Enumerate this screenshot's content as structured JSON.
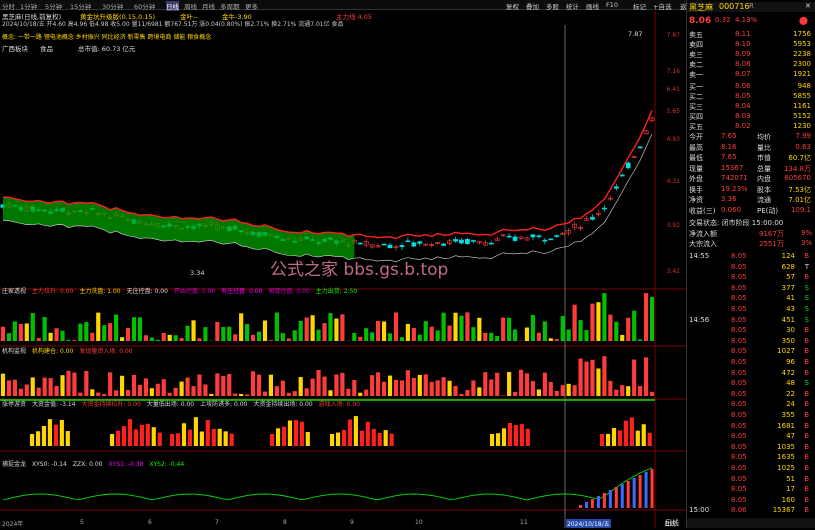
{
  "toolbar": {
    "periods": [
      "分时",
      "1分钟",
      "5分钟",
      "15分钟",
      "30分钟",
      "60分钟",
      "日线",
      "周线",
      "月线",
      "多周期",
      "更多"
    ],
    "active_period": "日线",
    "menu": [
      "复权",
      "叠加",
      "多股",
      "统计",
      "画线",
      "F10",
      "标记",
      "+自选",
      "返回"
    ]
  },
  "main": {
    "stock_label": "黑芝麻(日线,前复权)",
    "indicator_label": "黄金坑升级版(0.15,0.15)",
    "gold_line": "金叶--",
    "info_text": "2024/10/18/五 开4.60 高4.96 低4.98 收5.00 量11/6981 额767.51万 涨0.04(0.80%) 振2.71% 换2.71% 流通7.01亿 食品",
    "gold_line2": "金牛-3.90",
    "main_force_line": "主力线 4.05",
    "concept": "概念: 一带一路 锂电池概念 乡村振兴 同比经济 新零售 跨境电商 储能 粮食概念",
    "region": "广西板块",
    "industry": "食品",
    "total_cap": "总市值: 60.73 亿元",
    "low_label": "3.34",
    "high_label": "7.87",
    "price_axis": [
      "7.87",
      "7.16",
      "6.41",
      "5.65",
      "4.93",
      "4.31",
      "3.92",
      "3.42"
    ],
    "watermark": "公式之家 bbs.gs.b.top"
  },
  "panels": [
    {
      "name": "庄家透视",
      "items": [
        {
          "t": "主力拉升: 0.00",
          "c": "#ff3c3c"
        },
        {
          "t": "主力洗盘: 1.00",
          "c": "#ffd600"
        },
        {
          "t": "无庄控盘: 0.00",
          "c": "#ddd"
        },
        {
          "t": "开始控盘: 0.00",
          "c": "#c0c"
        },
        {
          "t": "有庄控盘: 0.00",
          "c": "#f0f"
        },
        {
          "t": "高度控盘: 0.00",
          "c": "#c0c"
        },
        {
          "t": "主力出货: 2.50",
          "c": "#0f0"
        }
      ]
    },
    {
      "name": "机构监视",
      "items": [
        {
          "t": "机构建仓: 0.00",
          "c": "#ffd600"
        },
        {
          "t": "发现量资入场: 0.00",
          "c": "#ff3c3c"
        }
      ]
    },
    {
      "name": "涨停游资",
      "items": [
        {
          "t": "大资金值: -3.14",
          "c": "#ddd"
        },
        {
          "t": "大资金持续拉升: 0.00",
          "c": "#ff3c3c"
        },
        {
          "t": "大量低出场: 0.00",
          "c": "#ddd"
        },
        {
          "t": "上攻防诱多: 0.00",
          "c": "#ddd"
        },
        {
          "t": "大资金持续出场: 0.00",
          "c": "#ddd"
        },
        {
          "t": "游戏入场: 0.00",
          "c": "#ff3c3c"
        }
      ]
    },
    {
      "name": "捕捉金龙",
      "items": [
        {
          "t": "XYS0: -0.14",
          "c": "#ddd"
        },
        {
          "t": "ZZX: 0.00",
          "c": "#ddd"
        },
        {
          "t": "XYS1: -0.38",
          "c": "#f0f"
        },
        {
          "t": "XYS2: -0.44",
          "c": "#0f0"
        }
      ]
    }
  ],
  "date_axis": {
    "labels": [
      "2024年",
      "5",
      "6",
      "7",
      "8",
      "9",
      "10",
      "11"
    ],
    "highlight": "2024/10/18/五",
    "mode": "日线"
  },
  "quote": {
    "name": "黑芝麻",
    "code": "000716",
    "flag": "R",
    "price": "8.06",
    "change": "0.32",
    "pct": "4.13%",
    "asks": [
      {
        "l": "卖五",
        "p": "8.11",
        "v": "1756"
      },
      {
        "l": "卖四",
        "p": "8.10",
        "v": "5953"
      },
      {
        "l": "卖三",
        "p": "8.09",
        "v": "2238"
      },
      {
        "l": "卖二",
        "p": "8.08",
        "v": "2300"
      },
      {
        "l": "卖一",
        "p": "8.07",
        "v": "1921"
      }
    ],
    "bids": [
      {
        "l": "买一",
        "p": "8.06",
        "v": "948"
      },
      {
        "l": "买二",
        "p": "8.05",
        "v": "5855"
      },
      {
        "l": "买三",
        "p": "8.04",
        "v": "1161"
      },
      {
        "l": "买四",
        "p": "8.03",
        "v": "5152"
      },
      {
        "l": "买五",
        "p": "8.02",
        "v": "1230"
      }
    ],
    "stats": [
      {
        "a": "今开",
        "av": "7.65",
        "b": "均价",
        "bv": "7.99"
      },
      {
        "a": "最高",
        "av": "8.16",
        "b": "量比",
        "bv": "0.63"
      },
      {
        "a": "最低",
        "av": "7.65",
        "b": "市值",
        "bv": "60.7亿"
      },
      {
        "a": "现量",
        "av": "15367",
        "b": "总量",
        "bv": "134.8万"
      },
      {
        "a": "外盘",
        "av": "742071",
        "b": "内盘",
        "bv": "605670"
      },
      {
        "a": "换手",
        "av": "19.23%",
        "b": "股本",
        "bv": "7.53亿"
      },
      {
        "a": "净资",
        "av": "3.36",
        "b": "流通",
        "bv": "7.01亿"
      },
      {
        "a": "收益(三)",
        "av": "0.060",
        "b": "PE(动)",
        "bv": "109.1"
      }
    ],
    "trade_status": "交易状态: 闭市阶段 15:00:00",
    "net_inflow_label": "净流入额",
    "net_inflow": "9167万",
    "net_inflow_pct": "9%",
    "big_inflow_label": "大宗流入",
    "big_inflow": "2551万",
    "big_inflow_pct": "3%",
    "ticks": [
      {
        "t": "14:55",
        "p": "8.05",
        "v": "124",
        "s": "B"
      },
      {
        "t": "",
        "p": "8.05",
        "v": "628",
        "s": "T"
      },
      {
        "t": "",
        "p": "8.05",
        "v": "57",
        "s": "B"
      },
      {
        "t": "",
        "p": "8.05",
        "v": "377",
        "s": "S"
      },
      {
        "t": "",
        "p": "8.05",
        "v": "41",
        "s": "S"
      },
      {
        "t": "",
        "p": "8.05",
        "v": "43",
        "s": "S"
      },
      {
        "t": "14:56",
        "p": "8.05",
        "v": "451",
        "s": "S"
      },
      {
        "t": "",
        "p": "8.05",
        "v": "30",
        "s": "B"
      },
      {
        "t": "",
        "p": "8.05",
        "v": "350",
        "s": "B"
      },
      {
        "t": "",
        "p": "8.05",
        "v": "1027",
        "s": "B"
      },
      {
        "t": "",
        "p": "8.05",
        "v": "96",
        "s": "B"
      },
      {
        "t": "",
        "p": "8.05",
        "v": "472",
        "s": "B"
      },
      {
        "t": "",
        "p": "8.05",
        "v": "48",
        "s": "S"
      },
      {
        "t": "",
        "p": "8.05",
        "v": "22",
        "s": "B"
      },
      {
        "t": "",
        "p": "8.05",
        "v": "24",
        "s": "B"
      },
      {
        "t": "",
        "p": "8.05",
        "v": "355",
        "s": "B"
      },
      {
        "t": "",
        "p": "8.05",
        "v": "1681",
        "s": "B"
      },
      {
        "t": "",
        "p": "8.05",
        "v": "47",
        "s": "B"
      },
      {
        "t": "",
        "p": "8.05",
        "v": "1035",
        "s": "B"
      },
      {
        "t": "",
        "p": "8.05",
        "v": "1635",
        "s": "B"
      },
      {
        "t": "",
        "p": "8.05",
        "v": "1025",
        "s": "B"
      },
      {
        "t": "",
        "p": "8.05",
        "v": "51",
        "s": "B"
      },
      {
        "t": "",
        "p": "8.05",
        "v": "17",
        "s": "B"
      },
      {
        "t": "",
        "p": "8.05",
        "v": "160",
        "s": "B"
      },
      {
        "t": "15:00",
        "p": "8.06",
        "v": "15367",
        "s": "B"
      }
    ],
    "bottom_tab": "日线"
  },
  "colors": {
    "up": "#ff3c3c",
    "down": "#00e000",
    "bg": "#000",
    "grid": "#7a0000"
  }
}
